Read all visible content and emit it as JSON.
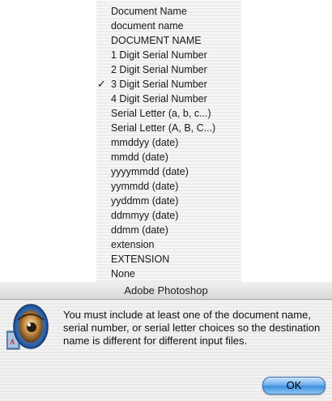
{
  "menu": {
    "items": [
      {
        "label": "Document Name",
        "checked": false
      },
      {
        "label": "document name",
        "checked": false
      },
      {
        "label": "DOCUMENT NAME",
        "checked": false
      },
      {
        "label": "1 Digit Serial Number",
        "checked": false
      },
      {
        "label": "2 Digit Serial Number",
        "checked": false
      },
      {
        "label": "3 Digit Serial Number",
        "checked": true
      },
      {
        "label": "4 Digit Serial Number",
        "checked": false
      },
      {
        "label": "Serial Letter (a, b, c...)",
        "checked": false
      },
      {
        "label": "Serial Letter (A, B, C...)",
        "checked": false
      },
      {
        "label": "mmddyy (date)",
        "checked": false
      },
      {
        "label": "mmdd (date)",
        "checked": false
      },
      {
        "label": "yyyymmdd (date)",
        "checked": false
      },
      {
        "label": "yymmdd (date)",
        "checked": false
      },
      {
        "label": "yyddmm (date)",
        "checked": false
      },
      {
        "label": "ddmmyy (date)",
        "checked": false
      },
      {
        "label": "ddmm (date)",
        "checked": false
      },
      {
        "label": "extension",
        "checked": false
      },
      {
        "label": "EXTENSION",
        "checked": false
      },
      {
        "label": "None",
        "checked": false
      }
    ],
    "check_glyph": "✓"
  },
  "dialog": {
    "title": "Adobe Photoshop",
    "icon": "photoshop-eye-icon",
    "message": "You must include at least one of the document name, serial number, or serial letter choices so the destination name is different for different input files.",
    "ok_label": "OK"
  }
}
